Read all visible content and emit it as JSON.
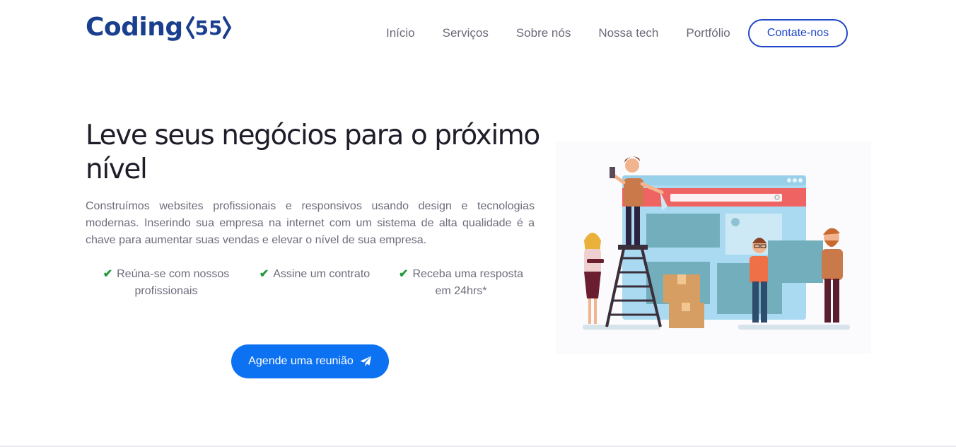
{
  "brand": {
    "word": "Coding",
    "mark": "55",
    "color": "#1b3f8f"
  },
  "nav": {
    "items": [
      {
        "label": "Início"
      },
      {
        "label": "Serviços"
      },
      {
        "label": "Sobre nós"
      },
      {
        "label": "Nossa tech"
      },
      {
        "label": "Portfólio"
      }
    ],
    "cta_label": "Contate-nos"
  },
  "hero": {
    "title": "Leve seus negócios para o próximo nível",
    "description": "Construímos websites profissionais e responsivos usando design e tecnologias modernas. Inserindo sua empresa na internet com um sistema de alta qualidade é a chave para aumentar suas vendas e elevar o nível de sua empresa.",
    "features": [
      {
        "label": "Reúna-se com nossos profissionais",
        "icon": "check-icon"
      },
      {
        "label": "Assine um contrato",
        "icon": "check-icon"
      },
      {
        "label": "Receba uma resposta em 24hrs*",
        "icon": "check-icon"
      }
    ],
    "button_label": "Agende uma reunião",
    "button_icon": "paper-plane-icon"
  },
  "colors": {
    "primary": "#0d72f2",
    "accent": "#1f47c9",
    "check": "#1f9a3a",
    "brand": "#1b3f8f"
  }
}
